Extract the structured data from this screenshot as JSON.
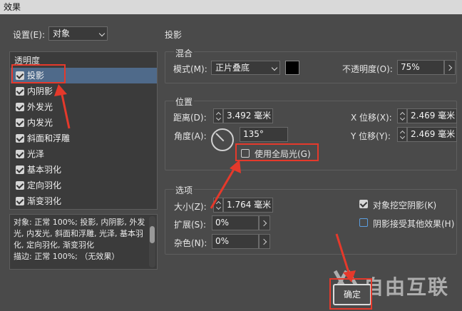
{
  "window": {
    "title": "效果"
  },
  "settings": {
    "label": "设置(E):",
    "value": "对象"
  },
  "left_panel": {
    "section_label": "透明度",
    "effects": [
      {
        "label": "投影",
        "checked": true,
        "selected": true
      },
      {
        "label": "内阴影",
        "checked": true
      },
      {
        "label": "外发光",
        "checked": true
      },
      {
        "label": "内发光",
        "checked": true
      },
      {
        "label": "斜面和浮雕",
        "checked": true
      },
      {
        "label": "光泽",
        "checked": true
      },
      {
        "label": "基本羽化",
        "checked": true
      },
      {
        "label": "定向羽化",
        "checked": true
      },
      {
        "label": "渐变羽化",
        "checked": true
      }
    ],
    "summary": "对象: 正常 100%; 投影, 内阴影, 外发光, 内发光, 斜面和浮雕, 光泽, 基本羽化, 定向羽化, 渐变羽化\n描边: 正常 100%; （无效果）"
  },
  "main": {
    "heading": "投影",
    "blend": {
      "title": "混合",
      "mode_label": "模式(M):",
      "mode_value": "正片叠底",
      "swatch_color": "#000000",
      "opacity_label": "不透明度(O):",
      "opacity_value": "75%"
    },
    "position": {
      "title": "位置",
      "distance_label": "距离(D):",
      "distance_value": "3.492 毫米",
      "angle_label": "角度(A):",
      "angle_value": "135°",
      "global_light_label": "使用全局光(G)",
      "global_light_checked": false,
      "x_offset_label": "X 位移(X):",
      "x_offset_value": "2.469 毫米",
      "y_offset_label": "Y 位移(Y):",
      "y_offset_value": "2.469 毫米"
    },
    "options": {
      "title": "选项",
      "size_label": "大小(Z):",
      "size_value": "1.764 毫米",
      "spread_label": "扩展(S):",
      "spread_value": "0%",
      "noise_label": "杂色(N):",
      "noise_value": "0%",
      "knockout_label": "对象挖空阴影(K)",
      "knockout_checked": true,
      "honor_label": "阴影接受其他效果(H)",
      "honor_checked": false
    }
  },
  "buttons": {
    "ok_label": "确定"
  },
  "watermark": {
    "text": "自由互联"
  },
  "annotation_color": "#e5392b"
}
